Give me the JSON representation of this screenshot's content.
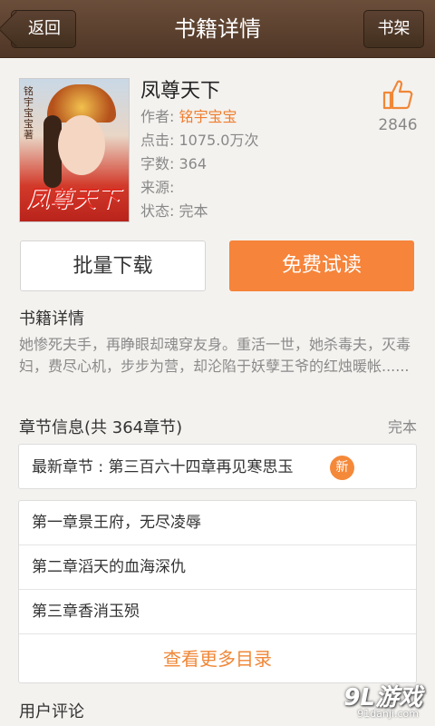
{
  "header": {
    "back_label": "返回",
    "title": "书籍详情",
    "shelf_label": "书架"
  },
  "book": {
    "title": "凤尊天下",
    "author_label": "作者: ",
    "author_name": "铭宇宝宝",
    "clicks": "点击: 1075.0万次",
    "words": "字数: 364",
    "source": "来源:",
    "status": "状态: 完本",
    "likes": "2846",
    "cover_title": "凤尊天下",
    "cover_author_vertical": "铭宇宝宝 著"
  },
  "actions": {
    "batch_download": "批量下载",
    "free_read": "免费试读"
  },
  "details": {
    "heading": "书籍详情",
    "description": "她惨死夫手，再睁眼却魂穿友身。重活一世，她杀毒夫，灭毒妇，费尽心机，步步为营，却沦陷于妖孽王爷的红烛暖帐......"
  },
  "chapters": {
    "heading": "章节信息(共 364章节)",
    "status": "完本",
    "latest": "最新章节 : 第三百六十四章再见寒思玉",
    "new_badge": "新",
    "items": [
      {
        "title": "第一章景王府，无尽凌辱"
      },
      {
        "title": "第二章滔天的血海深仇"
      },
      {
        "title": "第三章香消玉殒"
      }
    ],
    "more": "查看更多目录"
  },
  "reviews": {
    "heading": "用户评论"
  },
  "watermark": {
    "logo": "9L游戏",
    "url": "91danji.com"
  },
  "colors": {
    "accent": "#f6843a",
    "topbar": "#5a3f2e"
  }
}
